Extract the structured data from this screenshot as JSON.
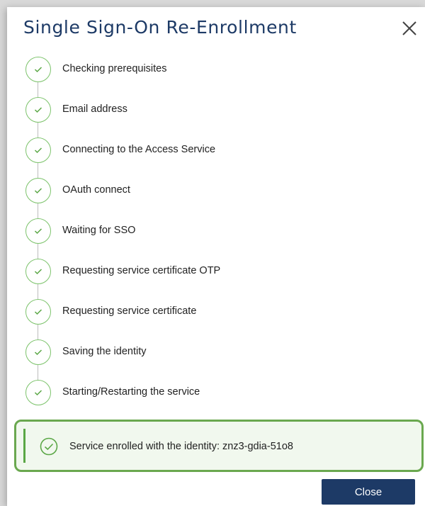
{
  "dialog": {
    "title": "Single Sign-On Re-Enrollment",
    "close_icon": "close-icon"
  },
  "steps": [
    {
      "label": "Checking prerequisites",
      "status": "complete"
    },
    {
      "label": "Email address",
      "status": "complete"
    },
    {
      "label": "Connecting to the Access Service",
      "status": "complete"
    },
    {
      "label": "OAuth connect",
      "status": "complete"
    },
    {
      "label": "Waiting for SSO",
      "status": "complete"
    },
    {
      "label": "Requesting service certificate OTP",
      "status": "complete"
    },
    {
      "label": "Requesting service certificate",
      "status": "complete"
    },
    {
      "label": "Saving the identity",
      "status": "complete"
    },
    {
      "label": "Starting/Restarting the service",
      "status": "complete"
    }
  ],
  "success": {
    "message": "Service enrolled with the identity: znz3-gdia-51o8",
    "icon": "check-circle-icon"
  },
  "footer": {
    "close_label": "Close"
  },
  "colors": {
    "brand": "#1d3a66",
    "success": "#6aa84f",
    "step_check": "#7cc36b"
  }
}
